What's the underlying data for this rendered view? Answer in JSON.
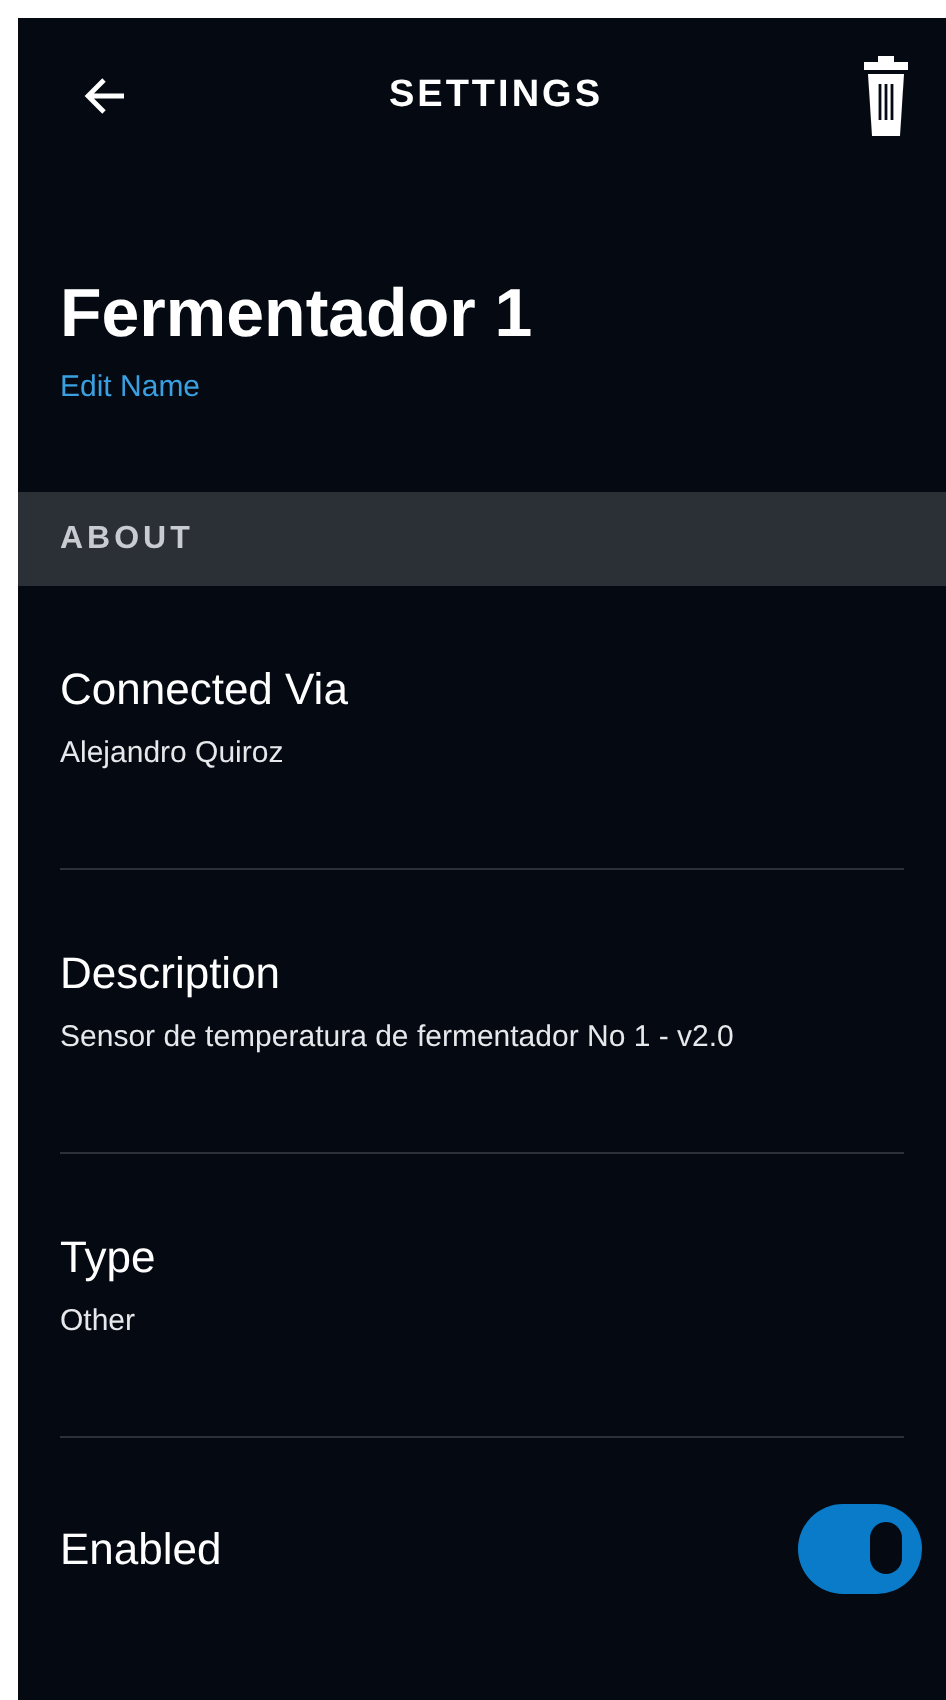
{
  "header": {
    "title": "SETTINGS"
  },
  "device": {
    "name": "Fermentador 1",
    "edit_link": "Edit Name"
  },
  "section": {
    "title": "ABOUT"
  },
  "rows": [
    {
      "kind": "info",
      "label": "Connected Via",
      "value": "Alejandro Quiroz"
    },
    {
      "kind": "info",
      "label": "Description",
      "value": "Sensor de temperatura de fermentador No 1 - v2.0"
    },
    {
      "kind": "info",
      "label": "Type",
      "value": "Other"
    },
    {
      "kind": "toggle",
      "label": "Enabled",
      "on": true
    }
  ]
}
